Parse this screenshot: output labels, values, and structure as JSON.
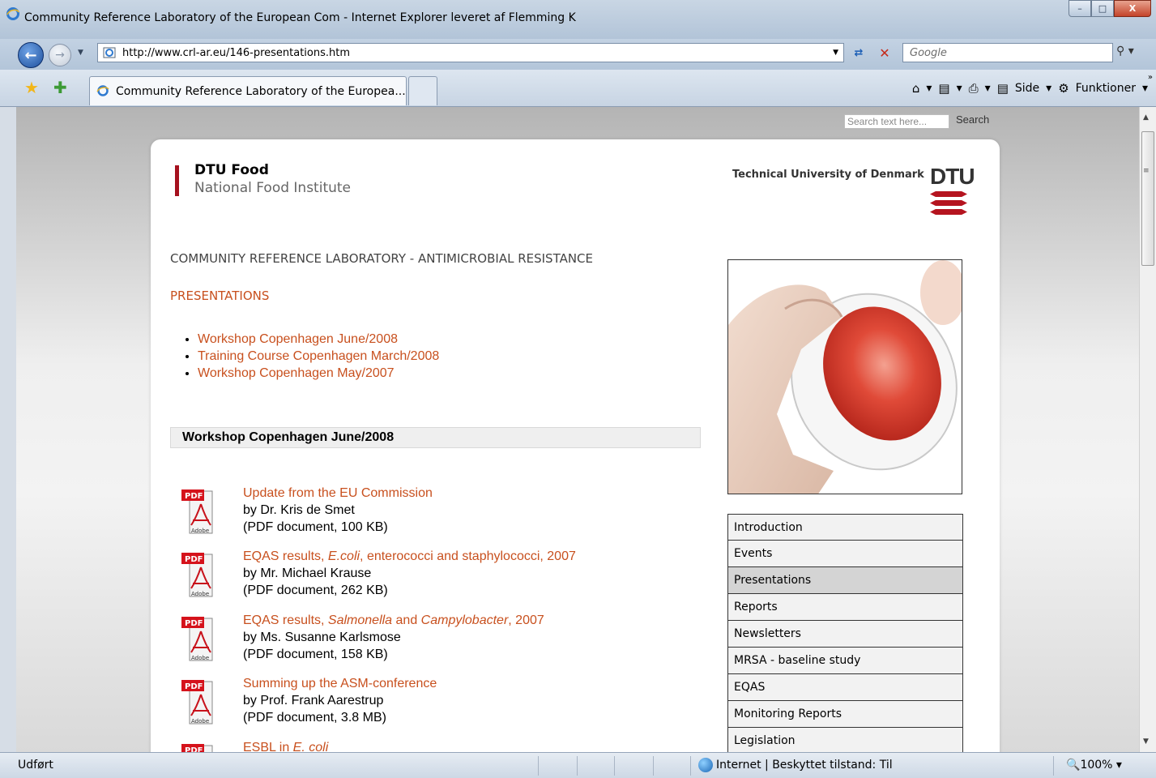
{
  "window": {
    "title": "Community Reference Laboratory of the European Com - Internet Explorer leveret af Flemming K",
    "min_glyph": "–",
    "max_glyph": "□",
    "close_glyph": "X"
  },
  "address": {
    "url": "http://www.crl-ar.eu/146-presentations.htm",
    "search_placeholder": "Google"
  },
  "tab": {
    "label": "Community Reference Laboratory of the Europea..."
  },
  "commandbar": {
    "page_label": "Side",
    "tools_label": "Funktioner"
  },
  "site_search": {
    "placeholder": "Search text here...",
    "button": "Search"
  },
  "header": {
    "logo_main": "DTU Food",
    "logo_sub": "National Food Institute",
    "university": "Technical University of Denmark",
    "dtu_letters": "DTU"
  },
  "content": {
    "crl_title": "COMMUNITY REFERENCE LABORATORY - ANTIMICROBIAL RESISTANCE",
    "presentations_title": "PRESENTATIONS",
    "presentation_links": [
      "Workshop Copenhagen June/2008",
      "Training Course Copenhagen March/2008",
      "Workshop Copenhagen May/2007"
    ],
    "section_heading": "Workshop Copenhagen June/2008",
    "documents": [
      {
        "title_parts": [
          "Update from the EU Commission"
        ],
        "italic": [
          false
        ],
        "by": "by Dr. Kris de Smet",
        "meta": "(PDF document, 100 KB)"
      },
      {
        "title_parts": [
          "EQAS results, ",
          "E.coli",
          ", enterococci and staphylococci, 2007"
        ],
        "italic": [
          false,
          true,
          false
        ],
        "by": "by Mr. Michael Krause",
        "meta": "(PDF document, 262 KB)"
      },
      {
        "title_parts": [
          "EQAS results, ",
          "Salmonella",
          " and ",
          "Campylobacter",
          ", 2007"
        ],
        "italic": [
          false,
          true,
          false,
          true,
          false
        ],
        "by": "by Ms. Susanne Karlsmose",
        "meta": "(PDF document, 158 KB)"
      },
      {
        "title_parts": [
          "Summing up the ASM-conference"
        ],
        "italic": [
          false
        ],
        "by": "by Prof. Frank Aarestrup",
        "meta": "(PDF document, 3.8 MB)"
      },
      {
        "title_parts": [
          "ESBL in ",
          "E. coli"
        ],
        "italic": [
          false,
          true
        ],
        "by": "",
        "meta": ""
      }
    ],
    "pdf_badge": "PDF",
    "adobe_label": "Adobe"
  },
  "menu": {
    "items": [
      "Introduction",
      "Events",
      "Presentations",
      "Reports",
      "Newsletters",
      "MRSA - baseline study",
      "EQAS",
      "Monitoring Reports",
      "Legislation"
    ],
    "active_index": 2
  },
  "statusbar": {
    "status": "Udført",
    "zone": "Internet | Beskyttet tilstand: Til",
    "zoom": "100%"
  },
  "colors": {
    "accent_link": "#c8501e",
    "dtu_red": "#a5111e"
  }
}
